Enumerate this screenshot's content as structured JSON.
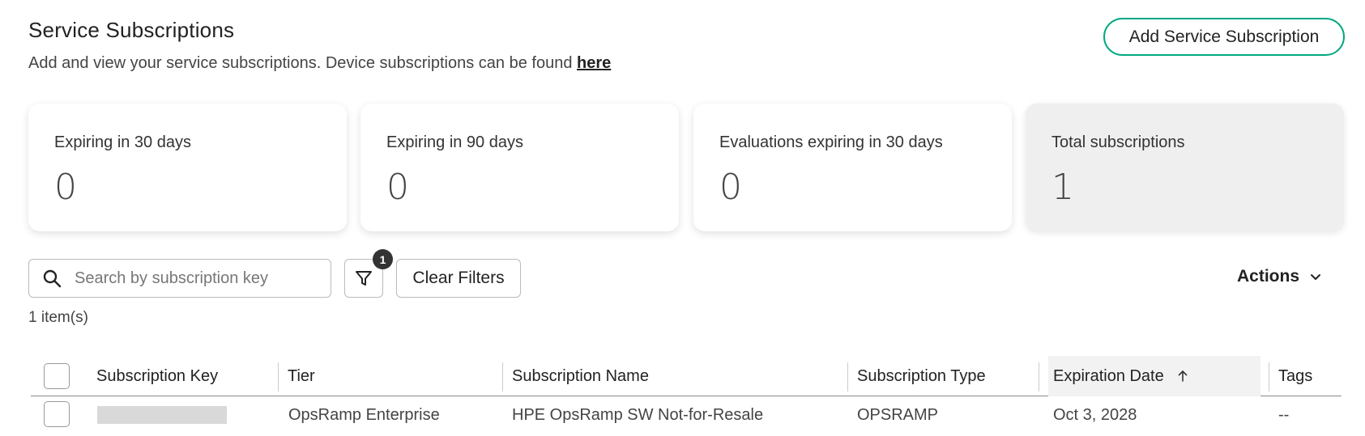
{
  "header": {
    "title": "Service Subscriptions",
    "subtitle_text": "Add and view your service subscriptions. Device subscriptions can be found ",
    "subtitle_link": "here",
    "add_button": "Add Service Subscription"
  },
  "cards": [
    {
      "label": "Expiring in 30 days",
      "value": "0"
    },
    {
      "label": "Expiring in 90 days",
      "value": "0"
    },
    {
      "label": "Evaluations expiring in 30 days",
      "value": "0"
    },
    {
      "label": "Total subscriptions",
      "value": "1"
    }
  ],
  "toolbar": {
    "search_placeholder": "Search by subscription key",
    "filter_badge": "1",
    "clear_filters": "Clear Filters",
    "actions": "Actions"
  },
  "item_count": "1 item(s)",
  "table": {
    "columns": [
      "Subscription Key",
      "Tier",
      "Subscription Name",
      "Subscription Type",
      "Expiration Date",
      "Tags"
    ],
    "sorted_column": "Expiration Date",
    "sort_direction": "ascending",
    "rows": [
      {
        "key": "",
        "tier": "OpsRamp Enterprise",
        "name": "HPE OpsRamp SW Not-for-Resale",
        "type": "OPSRAMP",
        "expiration": "Oct 3, 2028",
        "tags": "--"
      }
    ]
  },
  "colors": {
    "accent": "#01a982",
    "badge": "#333333",
    "total_card_bg": "#efefef"
  }
}
